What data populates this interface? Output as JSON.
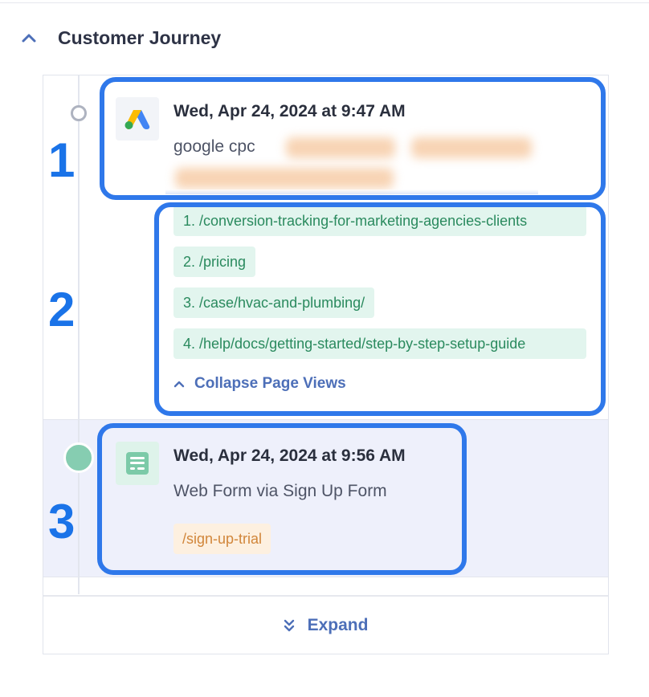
{
  "section": {
    "title": "Customer Journey"
  },
  "annotations": [
    "1",
    "2",
    "3"
  ],
  "events": [
    {
      "icon": "google-ads-icon",
      "time": "Wed, Apr 24, 2024 at 9:47 AM",
      "source": "google cpc"
    },
    {
      "icon": "web-form-icon",
      "time": "Wed, Apr 24, 2024 at 9:56 AM",
      "source": "Web Form via Sign Up Form",
      "url": "/sign-up-trial"
    }
  ],
  "page_views": [
    "1. /conversion-tracking-for-marketing-agencies-clients",
    "2. /pricing",
    "3. /case/hvac-and-plumbing/",
    "4. /help/docs/getting-started/step-by-step-setup-guide"
  ],
  "collapse_label": "Collapse Page Views",
  "expand_label": "Expand",
  "colors": {
    "highlight": "#2f78ea",
    "link": "#4d6fb8",
    "page_view_chip_bg": "#e2f5ee",
    "page_view_text": "#2a8a5e",
    "url_chip_bg": "#fdf0e0",
    "url_chip_text": "#d1863a",
    "dot_filled": "#86cdb1"
  }
}
